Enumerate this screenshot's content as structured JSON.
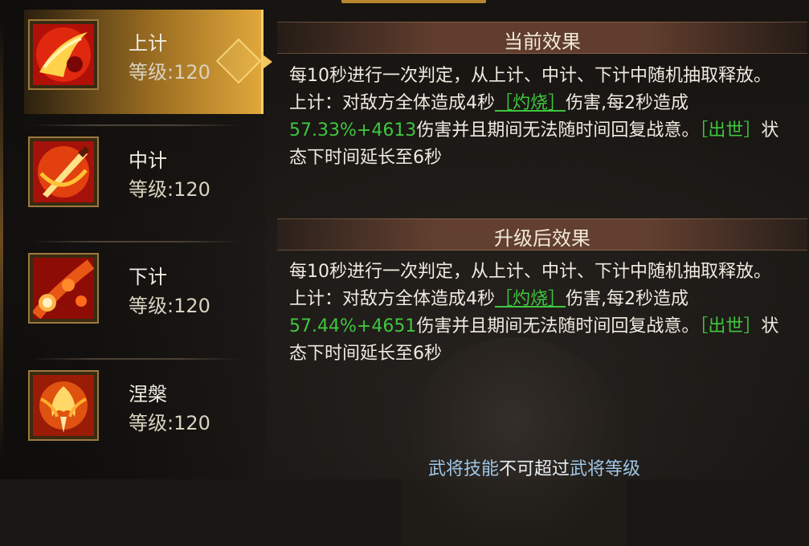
{
  "skills": [
    {
      "name": "上计",
      "level": "等级:120",
      "selected": true,
      "icon": "sword-slash-icon"
    },
    {
      "name": "中计",
      "level": "等级:120",
      "selected": false,
      "icon": "flame-blade-icon"
    },
    {
      "name": "下计",
      "level": "等级:120",
      "selected": false,
      "icon": "fireball-icon"
    },
    {
      "name": "涅槃",
      "level": "等级:120",
      "selected": false,
      "icon": "phoenix-icon"
    }
  ],
  "current": {
    "title": "当前效果",
    "parts": [
      "每10秒进行一次判定，从上计、中计、下计中随机抽取释放。上计：对敌方全体造成4秒",
      "［灼烧］",
      "伤害,每2秒造成",
      "57.33%+4613",
      "伤害并且期间无法随时间回复战意。",
      "［出世］",
      "状态下时间延长至6秒"
    ]
  },
  "upgraded": {
    "title": "升级后效果",
    "parts": [
      "每10秒进行一次判定，从上计、中计、下计中随机抽取释放。上计：对敌方全体造成4秒",
      "［灼烧］",
      "伤害,每2秒造成",
      "57.44%+4651",
      "伤害并且期间无法随时间回复战意。",
      "［出世］",
      "状态下时间延长至6秒"
    ]
  },
  "footer": {
    "prefix": "武将技能",
    "middle": "不可超过",
    "suffix": "武将等级"
  },
  "colors": {
    "highlight": "#3fc63f",
    "gold": "#f3c75a"
  }
}
